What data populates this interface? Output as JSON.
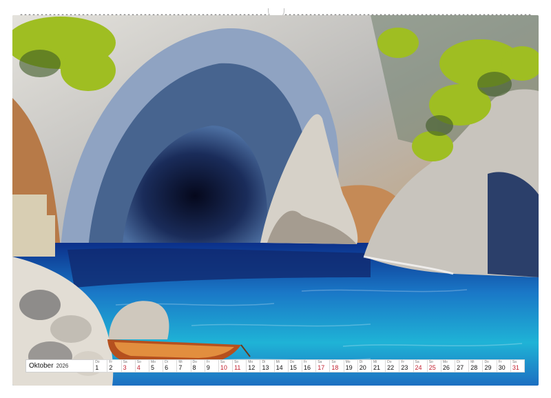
{
  "calendar": {
    "month": "Oktober",
    "year": "2026",
    "days": [
      {
        "wd": "Do",
        "n": "1",
        "weekend": false
      },
      {
        "wd": "Fr",
        "n": "2",
        "weekend": false
      },
      {
        "wd": "Sa",
        "n": "3",
        "weekend": true
      },
      {
        "wd": "So",
        "n": "4",
        "weekend": true
      },
      {
        "wd": "Mo",
        "n": "5",
        "weekend": false
      },
      {
        "wd": "Di",
        "n": "6",
        "weekend": false
      },
      {
        "wd": "Mi",
        "n": "7",
        "weekend": false
      },
      {
        "wd": "Do",
        "n": "8",
        "weekend": false
      },
      {
        "wd": "Fr",
        "n": "9",
        "weekend": false
      },
      {
        "wd": "Sa",
        "n": "10",
        "weekend": true
      },
      {
        "wd": "So",
        "n": "11",
        "weekend": true
      },
      {
        "wd": "Mo",
        "n": "12",
        "weekend": false
      },
      {
        "wd": "Di",
        "n": "13",
        "weekend": false
      },
      {
        "wd": "Mi",
        "n": "14",
        "weekend": false
      },
      {
        "wd": "Do",
        "n": "15",
        "weekend": false
      },
      {
        "wd": "Fr",
        "n": "16",
        "weekend": false
      },
      {
        "wd": "Sa",
        "n": "17",
        "weekend": true
      },
      {
        "wd": "So",
        "n": "18",
        "weekend": true
      },
      {
        "wd": "Mo",
        "n": "19",
        "weekend": false
      },
      {
        "wd": "Di",
        "n": "20",
        "weekend": false
      },
      {
        "wd": "Mi",
        "n": "21",
        "weekend": false
      },
      {
        "wd": "Do",
        "n": "22",
        "weekend": false
      },
      {
        "wd": "Fr",
        "n": "23",
        "weekend": false
      },
      {
        "wd": "Sa",
        "n": "24",
        "weekend": true
      },
      {
        "wd": "So",
        "n": "25",
        "weekend": true
      },
      {
        "wd": "Mo",
        "n": "26",
        "weekend": false
      },
      {
        "wd": "Di",
        "n": "27",
        "weekend": false
      },
      {
        "wd": "Mi",
        "n": "28",
        "weekend": false
      },
      {
        "wd": "Do",
        "n": "29",
        "weekend": false
      },
      {
        "wd": "Fr",
        "n": "30",
        "weekend": false
      },
      {
        "wd": "Sa",
        "n": "31",
        "weekend": true
      }
    ]
  },
  "colors": {
    "weekend": "#c2202f",
    "sea_turquoise": "#1fb3d6",
    "sea_deep": "#0b2f8a",
    "rock": "#c9c2b8",
    "foliage": "#b7cf2a"
  }
}
